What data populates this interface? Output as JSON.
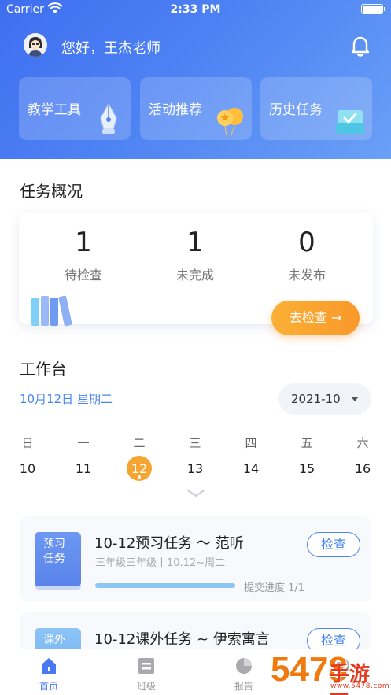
{
  "status_bar": {
    "carrier": "Carrier",
    "time": "2:33 PM"
  },
  "header": {
    "greeting": "您好，王杰老师",
    "quick_actions": [
      {
        "label": "教学工具",
        "icon": "pen-nib-icon"
      },
      {
        "label": "活动推荐",
        "icon": "balloon-icon"
      },
      {
        "label": "历史任务",
        "icon": "archive-box-icon"
      }
    ]
  },
  "overview": {
    "title": "任务概况",
    "stats": [
      {
        "value": "1",
        "label": "待检查"
      },
      {
        "value": "1",
        "label": "未完成"
      },
      {
        "value": "0",
        "label": "未发布"
      }
    ],
    "action_label": "去检查 →"
  },
  "workbench": {
    "title": "工作台",
    "date_label": "10月12日 星期二",
    "month": "2021-10",
    "weekdays": [
      "日",
      "一",
      "二",
      "三",
      "四",
      "五",
      "六"
    ],
    "days": [
      "10",
      "11",
      "12",
      "13",
      "14",
      "15",
      "16"
    ],
    "selected_day": "12"
  },
  "tasks": [
    {
      "cover_line1": "预习",
      "cover_line2": "任务",
      "title": "10-12预习任务 ～ 范听",
      "subtitle": "三年级三年级丨10.12~周二",
      "progress_text": "提交进度 1/1",
      "progress": 1.0,
      "button": "检查"
    },
    {
      "cover_line1": "课外",
      "cover_line2": "",
      "title": "10-12课外任务 ~ 伊索寓言",
      "button": "检查"
    }
  ],
  "tabbar": [
    {
      "label": "首页",
      "icon": "home-icon",
      "active": true
    },
    {
      "label": "班级",
      "icon": "class-icon",
      "active": false
    },
    {
      "label": "报告",
      "icon": "pie-chart-icon",
      "active": false
    },
    {
      "label": "",
      "icon": "profile-icon",
      "active": false
    }
  ],
  "watermark": {
    "digits": "5478",
    "text": "手游网",
    "url": "www.5478.com"
  },
  "colors": {
    "header_blue": "#4d82f3",
    "accent_orange": "#f9982a",
    "link_blue": "#4a86f0"
  }
}
